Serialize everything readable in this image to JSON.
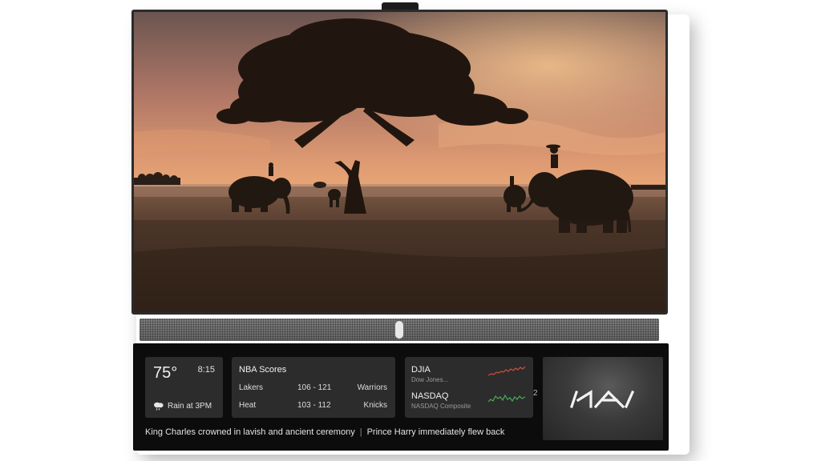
{
  "weather": {
    "temperature": "75°",
    "time": "8:15",
    "forecast": "Rain at 3PM",
    "icon": "cloud-rain-icon"
  },
  "nba": {
    "title": "NBA Scores",
    "games": [
      {
        "home": "Lakers",
        "score": "106 - 121",
        "away": "Warriors"
      },
      {
        "home": "Heat",
        "score": "103 - 112",
        "away": "Knicks"
      }
    ]
  },
  "stocks": {
    "items": [
      {
        "name": "DJIA",
        "subtitle": "Dow Jones...",
        "trend_color": "#d2513c"
      },
      {
        "name": "NASDAQ",
        "subtitle": "NASDAQ Composite",
        "trend_color": "#4cab5a"
      }
    ],
    "partial_glyph": "2"
  },
  "ad": {
    "brand": "KIA"
  },
  "ticker": {
    "headline_1": "King Charles crowned in lavish and ancient ceremony",
    "separator": "|",
    "headline_2": "Prince Harry immediately flew back"
  },
  "screen": {
    "scene": "savanna-sunset-elephants-image"
  }
}
